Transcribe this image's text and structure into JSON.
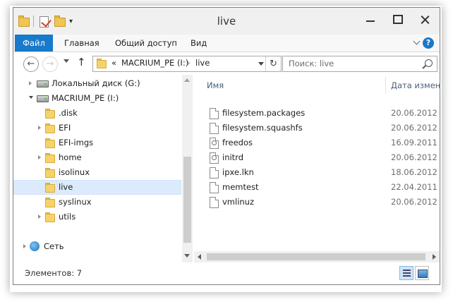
{
  "window": {
    "title": "live"
  },
  "ribbon": {
    "file_tab": "Файл",
    "tabs": [
      "Главная",
      "Общий доступ",
      "Вид"
    ],
    "help": "?"
  },
  "address": {
    "overflow": "«",
    "crumbs": [
      "MACRIUM_PE (I:)",
      "live"
    ],
    "separator": "›",
    "refresh_icon": "↻"
  },
  "search": {
    "placeholder": "Поиск: live"
  },
  "nav": {
    "back": "←",
    "forward": "→",
    "up": "↑"
  },
  "tree": [
    {
      "label": "Локальный диск (G:)",
      "icon": "drive-icon",
      "expander": "closed",
      "level": 0
    },
    {
      "label": "MACRIUM_PE (I:)",
      "icon": "drive-icon",
      "expander": "open",
      "level": 0
    },
    {
      "label": ".disk",
      "icon": "folder-icon",
      "expander": "none",
      "level": 1
    },
    {
      "label": "EFI",
      "icon": "folder-icon",
      "expander": "closed",
      "level": 1
    },
    {
      "label": "EFI-imgs",
      "icon": "folder-icon",
      "expander": "none",
      "level": 1
    },
    {
      "label": "home",
      "icon": "folder-icon",
      "expander": "closed",
      "level": 1
    },
    {
      "label": "isolinux",
      "icon": "folder-icon",
      "expander": "none",
      "level": 1
    },
    {
      "label": "live",
      "icon": "folder-icon",
      "expander": "none",
      "level": 1,
      "selected": true
    },
    {
      "label": "syslinux",
      "icon": "folder-icon",
      "expander": "none",
      "level": 1
    },
    {
      "label": "utils",
      "icon": "folder-icon",
      "expander": "closed",
      "level": 1
    },
    {
      "label": "Сеть",
      "icon": "network-icon",
      "expander": "closed",
      "level": 0
    }
  ],
  "columns": {
    "name": "Имя",
    "date": "Дата измен"
  },
  "files": [
    {
      "name": "filesystem.packages",
      "date": "20.06.2012",
      "icon": "file-icon"
    },
    {
      "name": "filesystem.squashfs",
      "date": "20.06.2012",
      "icon": "file-icon"
    },
    {
      "name": "freedos",
      "date": "16.09.2011",
      "icon": "settings-file-icon"
    },
    {
      "name": "initrd",
      "date": "20.06.2012",
      "icon": "settings-file-icon"
    },
    {
      "name": "ipxe.lkn",
      "date": "18.06.2012",
      "icon": "file-icon"
    },
    {
      "name": "memtest",
      "date": "22.04.2011",
      "icon": "file-icon"
    },
    {
      "name": "vmlinuz",
      "date": "20.06.2012",
      "icon": "file-icon"
    }
  ],
  "status": {
    "items_text": "Элементов: 7"
  },
  "colors": {
    "file_tab": "#1979ca",
    "selection": "#dcebfc",
    "folder": "#f6d36a"
  }
}
